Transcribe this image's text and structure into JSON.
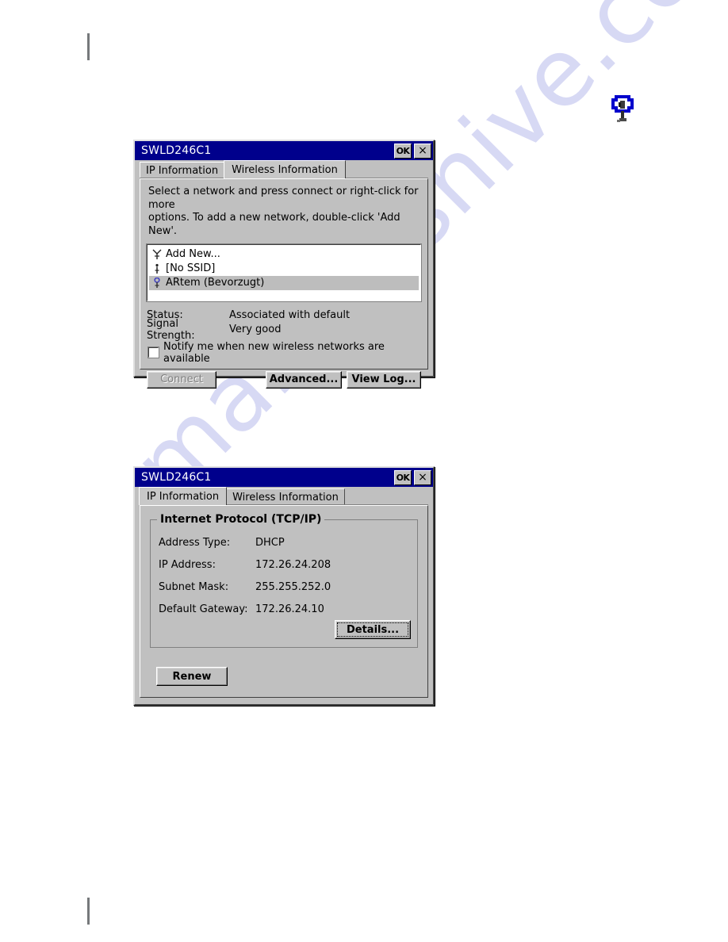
{
  "page": {
    "background_color": "#ffffff",
    "watermark_text": "manualshive.com",
    "watermark_color": "#c9cbf0",
    "crop_marks": {
      "color": "#76797b"
    }
  },
  "status_icon": {
    "name": "wireless-network-status-icon",
    "ring_color": "#0000cc",
    "body_color": "#3a3a3a"
  },
  "dialogs": {
    "wireless": {
      "title": "SWLD246C1",
      "titlebar_color": "#00008c",
      "buttons": {
        "ok": "OK",
        "close": "×"
      },
      "tabs": [
        {
          "label": "IP Information",
          "active": false
        },
        {
          "label": "Wireless Information",
          "active": true
        }
      ],
      "instructions_line1": "Select a network and press connect or right-click for more",
      "instructions_line2": "options.  To add a new network, double-click 'Add New'.",
      "networks": [
        {
          "label": "Add New...",
          "icon": "antenna-add-icon",
          "selected": false
        },
        {
          "label": "[No SSID]",
          "icon": "antenna-small-icon",
          "selected": false
        },
        {
          "label": "ARtem (Bevorzugt)",
          "icon": "antenna-preferred-icon",
          "selected": true
        }
      ],
      "status": {
        "status_key": "Status:",
        "status_value": "Associated with default",
        "signal_key": "Signal Strength:",
        "signal_value": "Very good"
      },
      "notify_checkbox": {
        "label": "Notify me when new wireless networks are available",
        "checked": false
      },
      "actions": {
        "connect": "Connect",
        "connect_enabled": false,
        "advanced": "Advanced...",
        "view_log": "View Log..."
      }
    },
    "ip": {
      "title": "SWLD246C1",
      "titlebar_color": "#00008c",
      "buttons": {
        "ok": "OK",
        "close": "×"
      },
      "tabs": [
        {
          "label": "IP Information",
          "active": true
        },
        {
          "label": "Wireless Information",
          "active": false
        }
      ],
      "group_title": "Internet Protocol (TCP/IP)",
      "fields": [
        {
          "key": "Address Type:",
          "value": "DHCP"
        },
        {
          "key": "IP Address:",
          "value": "172.26.24.208"
        },
        {
          "key": "Subnet Mask:",
          "value": "255.255.252.0"
        },
        {
          "key": "Default Gateway:",
          "value": "172.26.24.10"
        }
      ],
      "actions": {
        "details": "Details...",
        "renew": "Renew"
      }
    }
  }
}
